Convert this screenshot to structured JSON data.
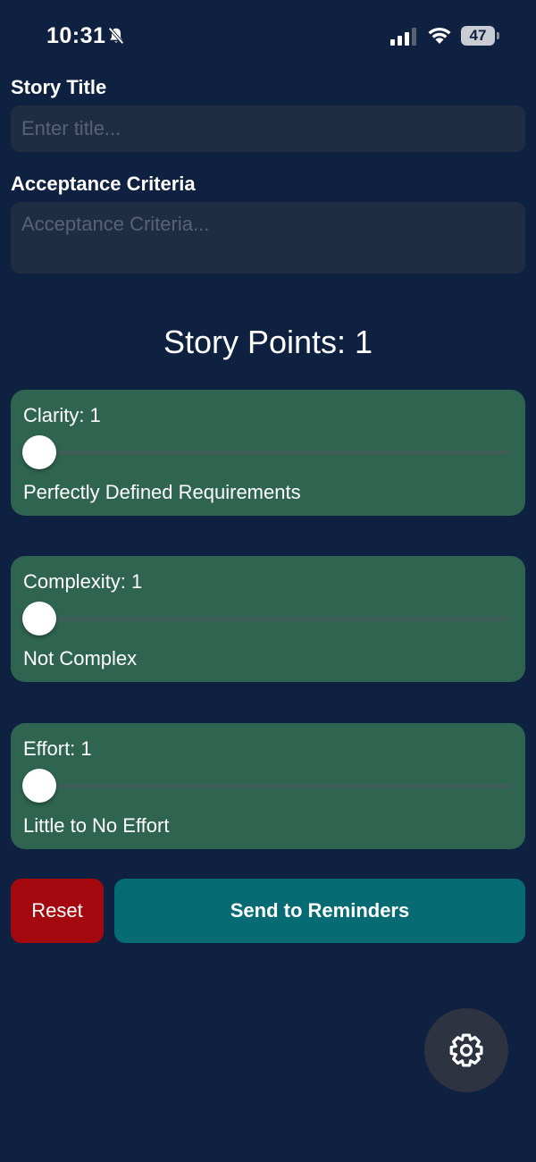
{
  "status_bar": {
    "time": "10:31",
    "battery": "47"
  },
  "form": {
    "title_label": "Story Title",
    "title_placeholder": "Enter title...",
    "criteria_label": "Acceptance Criteria",
    "criteria_placeholder": "Acceptance Criteria..."
  },
  "story_points": {
    "heading": "Story Points: 1"
  },
  "factors": [
    {
      "label": "Clarity: 1",
      "description": "Perfectly Defined Requirements",
      "value": 1
    },
    {
      "label": "Complexity: 1",
      "description": "Not Complex",
      "value": 1
    },
    {
      "label": "Effort: 1",
      "description": "Little to No Effort",
      "value": 1
    }
  ],
  "actions": {
    "reset_label": "Reset",
    "send_label": "Send to Reminders"
  },
  "icons": {
    "settings": "gear-icon",
    "silent": "bell-slash-icon",
    "signal": "cellular-signal-icon",
    "wifi": "wifi-icon"
  },
  "colors": {
    "background": "#0f2140",
    "card": "#2e6450",
    "reset": "#a3090f",
    "send": "#066b72"
  }
}
